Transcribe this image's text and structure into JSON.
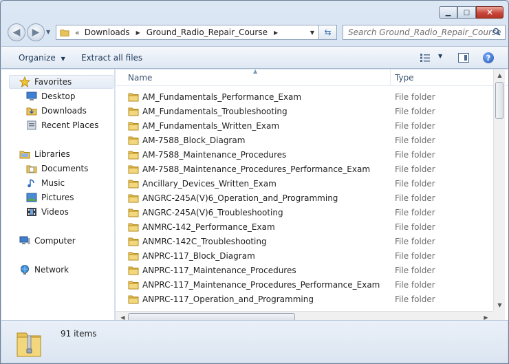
{
  "window": {
    "controls": {
      "minimize": "▁",
      "maximize": "□",
      "close": "✕"
    }
  },
  "address": {
    "overflow_chevron": "«",
    "crumbs": [
      "Downloads",
      "Ground_Radio_Repair_Course"
    ],
    "search_placeholder": "Search Ground_Radio_Repair_Course"
  },
  "toolbar": {
    "organize_label": "Organize",
    "extract_label": "Extract all files"
  },
  "nav": {
    "favorites": "Favorites",
    "desktop": "Desktop",
    "downloads": "Downloads",
    "recent_places": "Recent Places",
    "libraries": "Libraries",
    "documents": "Documents",
    "music": "Music",
    "pictures": "Pictures",
    "videos": "Videos",
    "computer": "Computer",
    "network": "Network"
  },
  "columns": {
    "name": "Name",
    "type": "Type"
  },
  "files": [
    {
      "name": "AM_Fundamentals_Performance_Exam",
      "type": "File folder"
    },
    {
      "name": "AM_Fundamentals_Troubleshooting",
      "type": "File folder"
    },
    {
      "name": "AM_Fundamentals_Written_Exam",
      "type": "File folder"
    },
    {
      "name": "AM-7588_Block_Diagram",
      "type": "File folder"
    },
    {
      "name": "AM-7588_Maintenance_Procedures",
      "type": "File folder"
    },
    {
      "name": "AM-7588_Maintenance_Procedures_Performance_Exam",
      "type": "File folder"
    },
    {
      "name": "Ancillary_Devices_Written_Exam",
      "type": "File folder"
    },
    {
      "name": "ANGRC-245A(V)6_Operation_and_Programming",
      "type": "File folder"
    },
    {
      "name": "ANGRC-245A(V)6_Troubleshooting",
      "type": "File folder"
    },
    {
      "name": "ANMRC-142_Performance_Exam",
      "type": "File folder"
    },
    {
      "name": "ANMRC-142C_Troubleshooting",
      "type": "File folder"
    },
    {
      "name": "ANPRC-117_Block_Diagram",
      "type": "File folder"
    },
    {
      "name": "ANPRC-117_Maintenance_Procedures",
      "type": "File folder"
    },
    {
      "name": "ANPRC-117_Maintenance_Procedures_Performance_Exam",
      "type": "File folder"
    },
    {
      "name": "ANPRC-117_Operation_and_Programming",
      "type": "File folder"
    }
  ],
  "status": {
    "item_count": "91 items"
  },
  "colors": {
    "folder": "#e8c25a",
    "accent": "#1e395b"
  }
}
